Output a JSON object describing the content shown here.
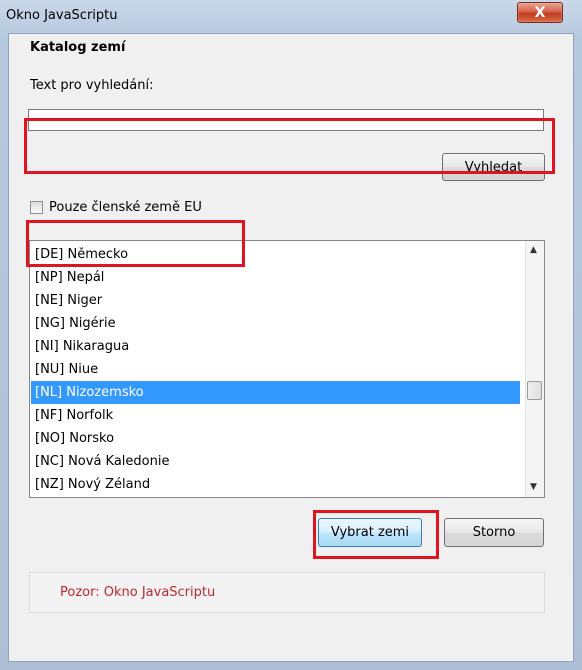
{
  "window": {
    "title": "Okno JavaScriptu",
    "close_label": "X"
  },
  "dialog": {
    "heading": "Katalog zemí",
    "search_label": "Text pro vyhledání:",
    "search_value": "",
    "search_button": "Vyhledat",
    "eu_only_label": "Pouze členské země EU",
    "eu_only_checked": false,
    "countries": [
      "[DE] Německo",
      "[NP] Nepál",
      "[NE] Niger",
      "[NG] Nigérie",
      "[NI] Nikaragua",
      "[NU] Niue",
      "[NL] Nizozemsko",
      "[NF] Norfolk",
      "[NO] Norsko",
      "[NC] Nová Kaledonie",
      "[NZ] Nový Zéland"
    ],
    "selected_country": "[NL] Nizozemsko",
    "select_button": "Vybrat zemi",
    "cancel_button": "Storno",
    "warning_text": "Pozor: Okno JavaScriptu"
  },
  "colors": {
    "selection": "#3399ff",
    "highlight": "#e0141e",
    "warning": "#c1272d"
  }
}
